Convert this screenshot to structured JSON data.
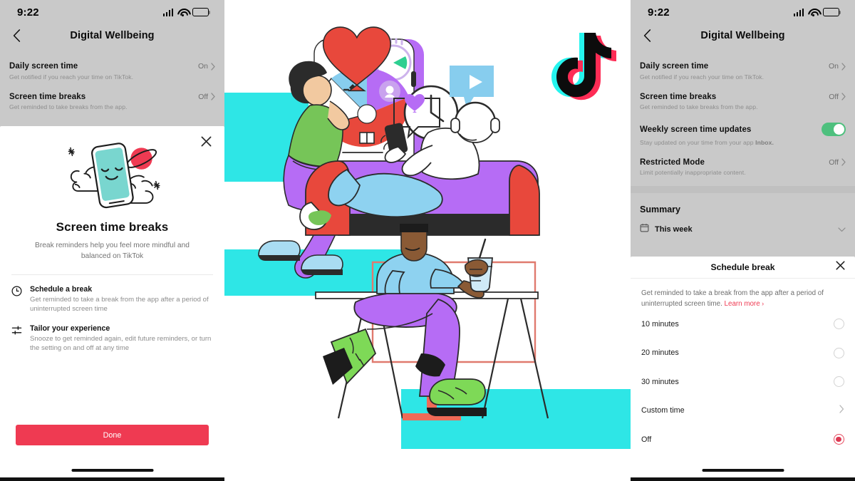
{
  "left_phone": {
    "status": {
      "time": "9:22",
      "signal_icon": "cellular-bars-icon",
      "wifi_icon": "wifi-icon",
      "battery_icon": "battery-icon"
    },
    "nav": {
      "back_icon": "chevron-left-icon",
      "title": "Digital Wellbeing"
    },
    "settings": [
      {
        "title": "Daily screen time",
        "value": "On",
        "subtitle": "Get notified if you reach your time on TikTok."
      },
      {
        "title": "Screen time breaks",
        "value": "Off",
        "subtitle": "Get reminded to take breaks from the app."
      }
    ],
    "sheet": {
      "close_icon": "close-icon",
      "art_icon": "sleeping-phone-clouds-illustration",
      "title": "Screen time breaks",
      "subtitle": "Break reminders help you feel more mindful and balanced on TikTok",
      "features": [
        {
          "icon": "clock-icon",
          "title": "Schedule a break",
          "desc": "Get reminded to take a break from the app after a period of uninterrupted screen time"
        },
        {
          "icon": "sliders-icon",
          "title": "Tailor your experience",
          "desc": "Snooze to get reminded again, edit future reminders, or turn the setting on and off at any time"
        }
      ],
      "done_label": "Done",
      "accent_color": "#ef3a52"
    }
  },
  "right_phone": {
    "status": {
      "time": "9:22",
      "signal_icon": "cellular-bars-icon",
      "wifi_icon": "wifi-icon",
      "battery_icon": "battery-icon"
    },
    "nav": {
      "back_icon": "chevron-left-icon",
      "title": "Digital Wellbeing"
    },
    "settings": [
      {
        "title": "Daily screen time",
        "value": "On",
        "subtitle": "Get notified if you reach your time on TikTok."
      },
      {
        "title": "Screen time breaks",
        "value": "Off",
        "subtitle": "Get reminded to take breaks from the app."
      },
      {
        "title": "Weekly screen time updates",
        "value": "",
        "subtitle_pre": "Stay updated on your time from your app ",
        "subtitle_bold": "Inbox.",
        "toggle": "on"
      },
      {
        "title": "Restricted Mode",
        "value": "Off",
        "subtitle": "Limit potentially inappropriate content."
      }
    ],
    "summary": {
      "heading": "Summary",
      "row_label": "This week",
      "row_icon": "calendar-icon",
      "row_chev": "chevron-down-icon"
    },
    "sheet": {
      "title": "Schedule break",
      "close_icon": "close-icon",
      "desc_pre": "Get reminded to take a break from the app after a period of uninterrupted screen time. ",
      "desc_link": "Learn more",
      "options": [
        {
          "label": "10 minutes",
          "control": "radio",
          "selected": false
        },
        {
          "label": "20 minutes",
          "control": "radio",
          "selected": false
        },
        {
          "label": "30 minutes",
          "control": "radio",
          "selected": false
        },
        {
          "label": "Custom time",
          "control": "chevron"
        },
        {
          "label": "Off",
          "control": "radio",
          "selected": true
        }
      ],
      "accent_color": "#ef3a52"
    }
  },
  "center_illustration": {
    "name": "tiktok-digital-wellbeing-illustration",
    "brand_logo": "tiktok-logo-icon",
    "palette": {
      "cyan": "#2ee6e6",
      "purple": "#b66cf5",
      "red": "#e8483c",
      "blue": "#8ed2f0",
      "green": "#7ed957",
      "light_blue": "#87cdee",
      "skin_light": "#f2c9a0",
      "skin_dark": "#8a5a35"
    },
    "elements": [
      "phone-screen-with-pie-chart",
      "heart-shape",
      "stopwatch-icon",
      "person-leaning-on-phone",
      "person-on-couch-with-headphones",
      "clock-icon",
      "play-bubble-icon",
      "heart-bubble-icon",
      "person-at-desk-with-drink",
      "tiktok-logo-icon"
    ]
  }
}
